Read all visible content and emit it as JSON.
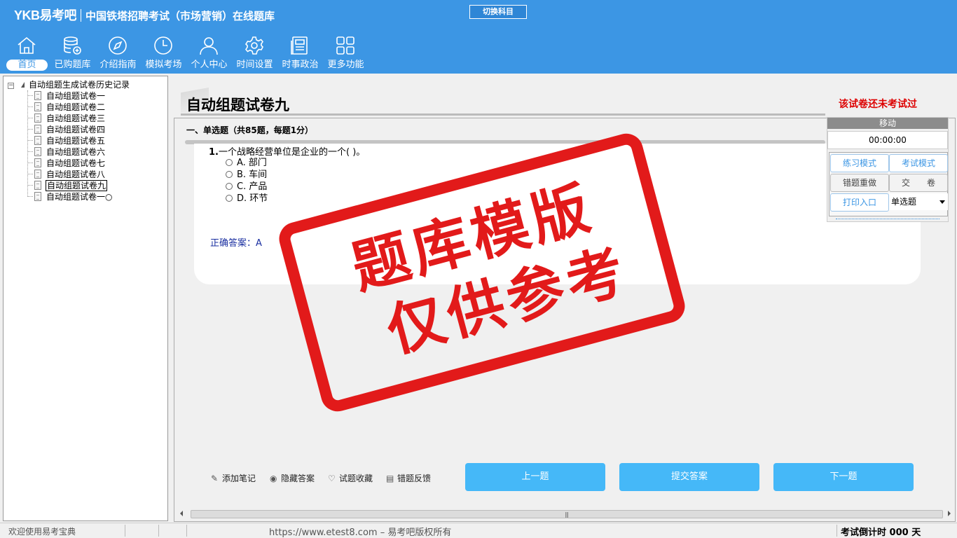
{
  "header": {
    "brand": "YKB易考吧",
    "title": "中国铁塔招聘考试（市场营销）在线题库",
    "switch_button": "切换科目"
  },
  "nav": [
    {
      "label": "首页",
      "icon": "home-icon"
    },
    {
      "label": "已购题库",
      "icon": "database-icon"
    },
    {
      "label": "介绍指南",
      "icon": "compass-icon"
    },
    {
      "label": "模拟考场",
      "icon": "clock-icon"
    },
    {
      "label": "个人中心",
      "icon": "user-icon"
    },
    {
      "label": "时间设置",
      "icon": "gear-icon"
    },
    {
      "label": "时事政治",
      "icon": "newspaper-icon"
    },
    {
      "label": "更多功能",
      "icon": "grid-icon"
    }
  ],
  "tree": {
    "root_label": "自动组题生成试卷历史记录",
    "toggle": "⊟",
    "items": [
      "自动组题试卷一",
      "自动组题试卷二",
      "自动组题试卷三",
      "自动组题试卷四",
      "自动组题试卷五",
      "自动组题试卷六",
      "自动组题试卷七",
      "自动组题试卷八",
      "自动组题试卷九",
      "自动组题试卷一○"
    ],
    "selected_index": 8
  },
  "paper": {
    "title": "自动组题试卷九",
    "status": "该试卷还未考试过",
    "section_heading": "一、单选题（共85题，每题1分）"
  },
  "question": {
    "number": "1.",
    "stem": "一个战略经营单位是企业的一个( )。",
    "options": [
      "A. 部门",
      "B. 车间",
      "C. 产品",
      "D. 环节"
    ],
    "answer_label": "正确答案：",
    "answer_value": "A"
  },
  "watermark": {
    "line1": "题库模版",
    "line2": "仅供参考"
  },
  "panel": {
    "move_label": "移动",
    "timer": "00:00:00",
    "practice_mode": "练习模式",
    "exam_mode": "考试模式",
    "redo_wrong": "错题重做",
    "submit_paper": "交　　卷",
    "print_entry": "打印入口",
    "question_type": "单选题"
  },
  "actions": {
    "add_note": "添加笔记",
    "hide_answer": "隐藏答案",
    "favorite": "试题收藏",
    "error_report": "错题反馈",
    "prev": "上一题",
    "submit_answer": "提交答案",
    "next": "下一题"
  },
  "statusbar": {
    "welcome": "欢迎使用易考宝典",
    "copyright": "https://www.etest8.com – 易考吧版权所有",
    "countdown": "考试倒计时 000 天"
  },
  "colors": {
    "header_bg": "#3c96e4",
    "button_blue": "#45b8f8",
    "status_red": "#dd0000",
    "stamp_red": "#e21a1a",
    "answer_blue": "#1a2fa0"
  }
}
